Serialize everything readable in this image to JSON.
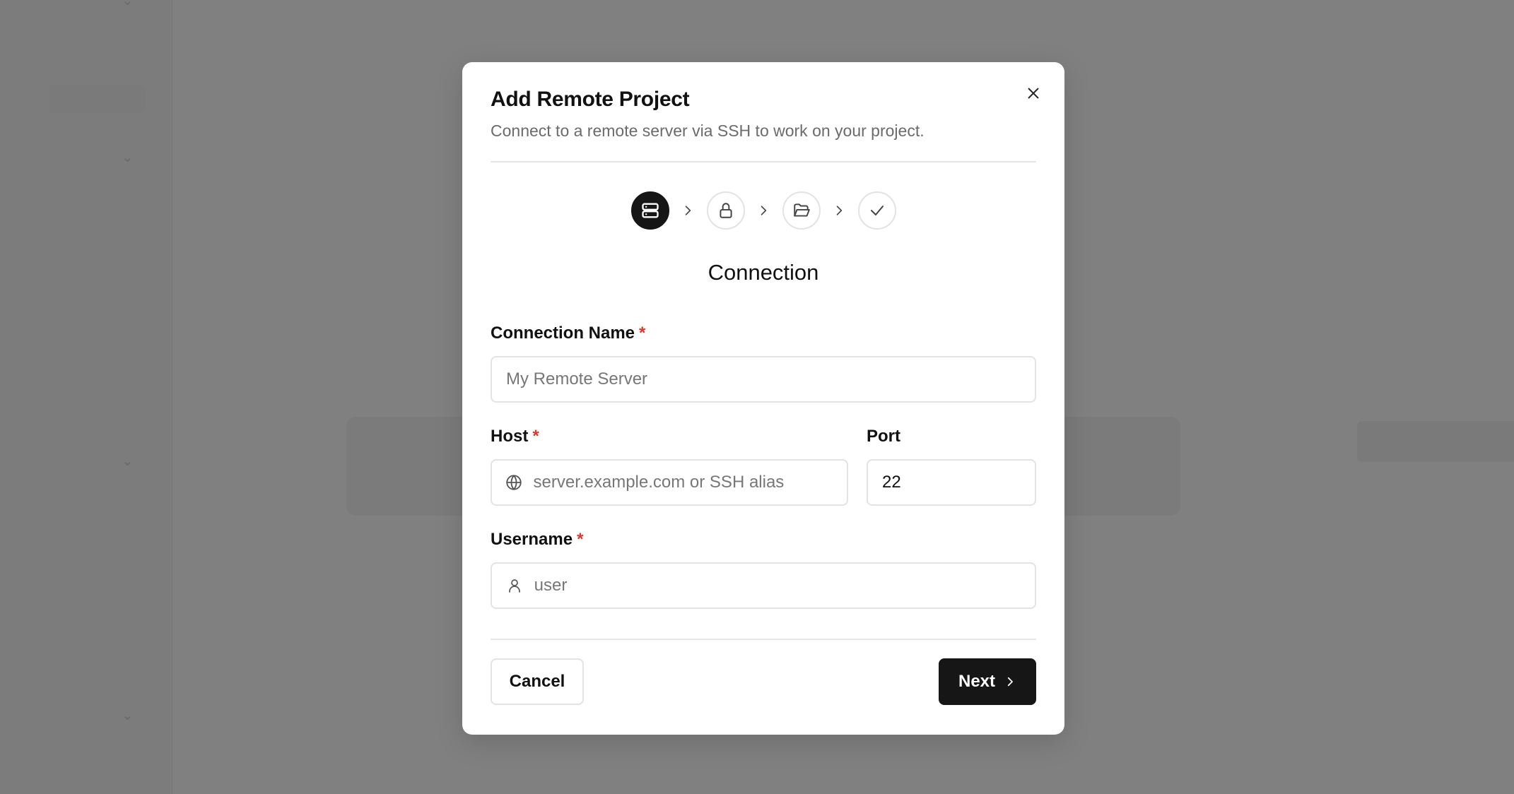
{
  "dialog": {
    "title": "Add Remote Project",
    "subtitle": "Connect to a remote server via SSH to work on your project.",
    "close_icon": "close-icon"
  },
  "steps": [
    {
      "icon": "server-icon",
      "state": "active"
    },
    {
      "icon": "lock-icon",
      "state": "pending"
    },
    {
      "icon": "folder-open-icon",
      "state": "pending"
    },
    {
      "icon": "check-icon",
      "state": "pending"
    }
  ],
  "section_title": "Connection",
  "form": {
    "connection_name": {
      "label": "Connection Name",
      "required": "*",
      "value": "",
      "placeholder": "My Remote Server"
    },
    "host": {
      "label": "Host",
      "required": "*",
      "value": "",
      "placeholder": "server.example.com or SSH alias",
      "icon": "globe-icon"
    },
    "port": {
      "label": "Port",
      "value": "22",
      "placeholder": ""
    },
    "username": {
      "label": "Username",
      "required": "*",
      "value": "",
      "placeholder": "user",
      "icon": "user-icon"
    }
  },
  "actions": {
    "cancel_label": "Cancel",
    "next_label": "Next"
  },
  "colors": {
    "accent": "#161616",
    "required": "#e5352b",
    "overlay": "#808080"
  }
}
